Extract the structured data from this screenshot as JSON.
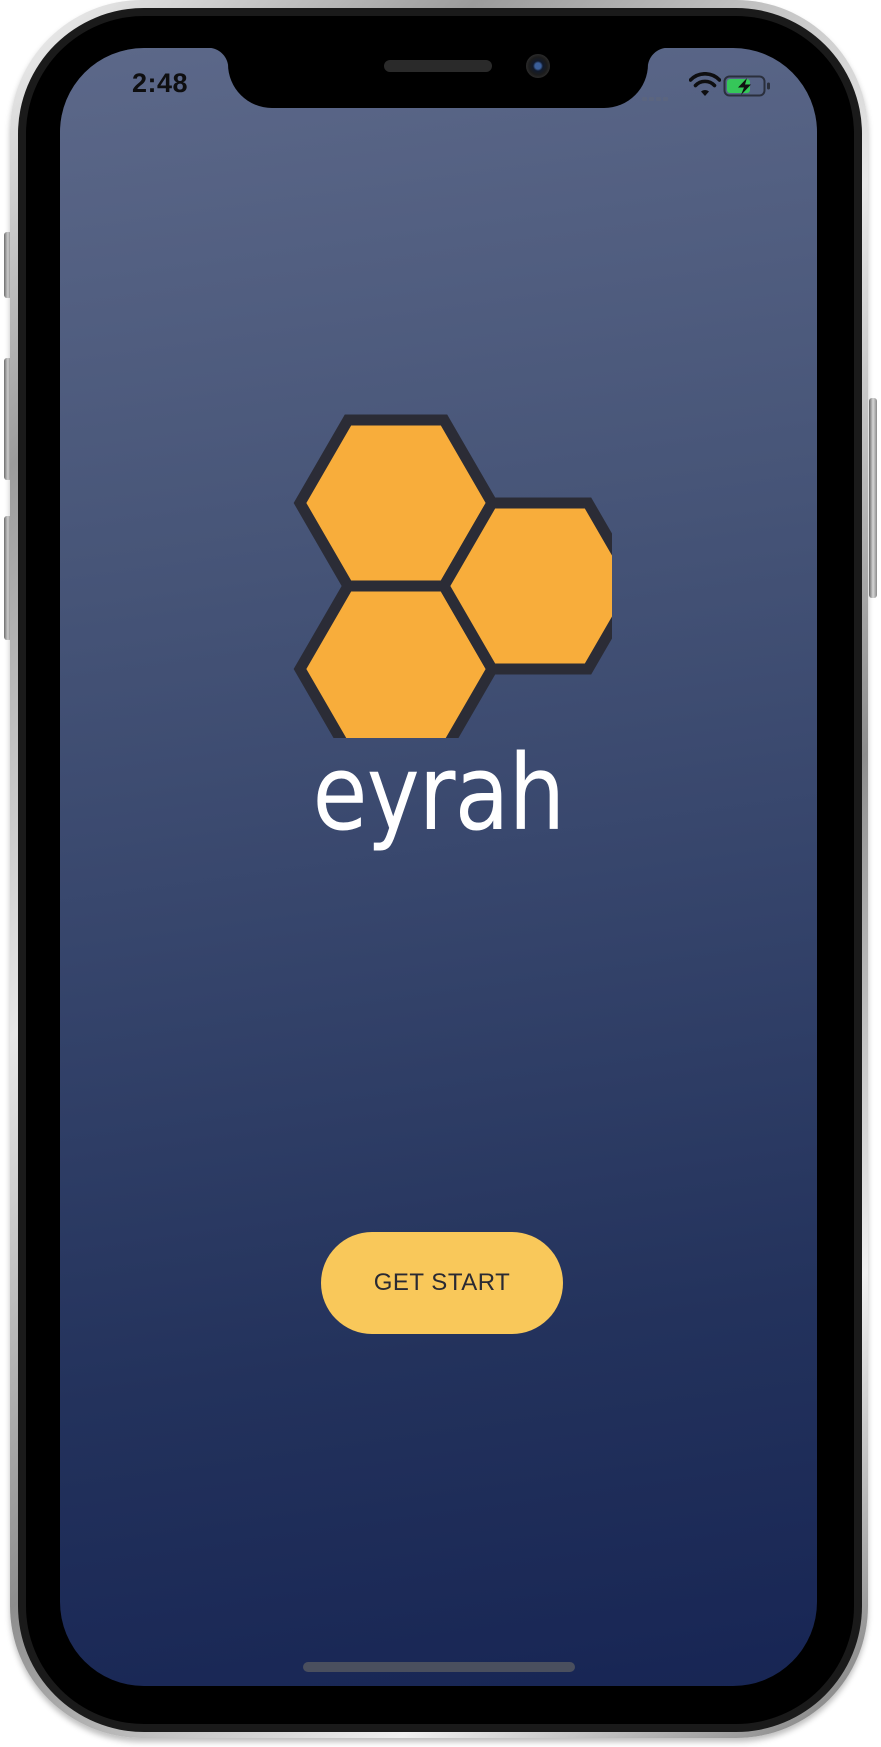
{
  "status_bar": {
    "time": "2:48",
    "icons": [
      "signal-dots-icon",
      "wifi-icon",
      "battery-charging-icon"
    ],
    "battery_color": "#35c759"
  },
  "brand": {
    "logo_icon": "honeycomb-logo-icon",
    "name": "eyrah",
    "logo_fill": "#f8ad3b",
    "logo_stroke": "#2b2c36"
  },
  "cta": {
    "label": "GET START",
    "color": "#f9c85a"
  },
  "theme": {
    "background_top": "#5c6889",
    "background_bottom": "#172554"
  }
}
